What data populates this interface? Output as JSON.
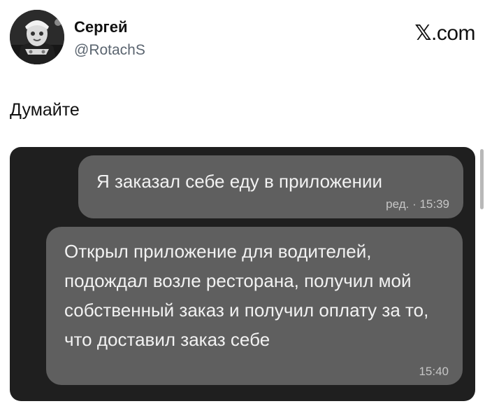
{
  "author": {
    "name": "Сергей",
    "handle": "@RotachS",
    "avatar_icon": "profile-photo"
  },
  "site": {
    "logo_letter": "𝕏",
    "domain": ".com"
  },
  "tweet": {
    "text": "Думайте"
  },
  "chat": {
    "messages": [
      {
        "text": "Я заказал себе еду в приложении",
        "meta": "ред. · 15:39"
      },
      {
        "text": "Открыл приложение для водителей, подождал возле ресторана, получил мой собственный заказ и получил оплату за то, что доставил заказ себе",
        "meta": "15:40"
      }
    ]
  }
}
